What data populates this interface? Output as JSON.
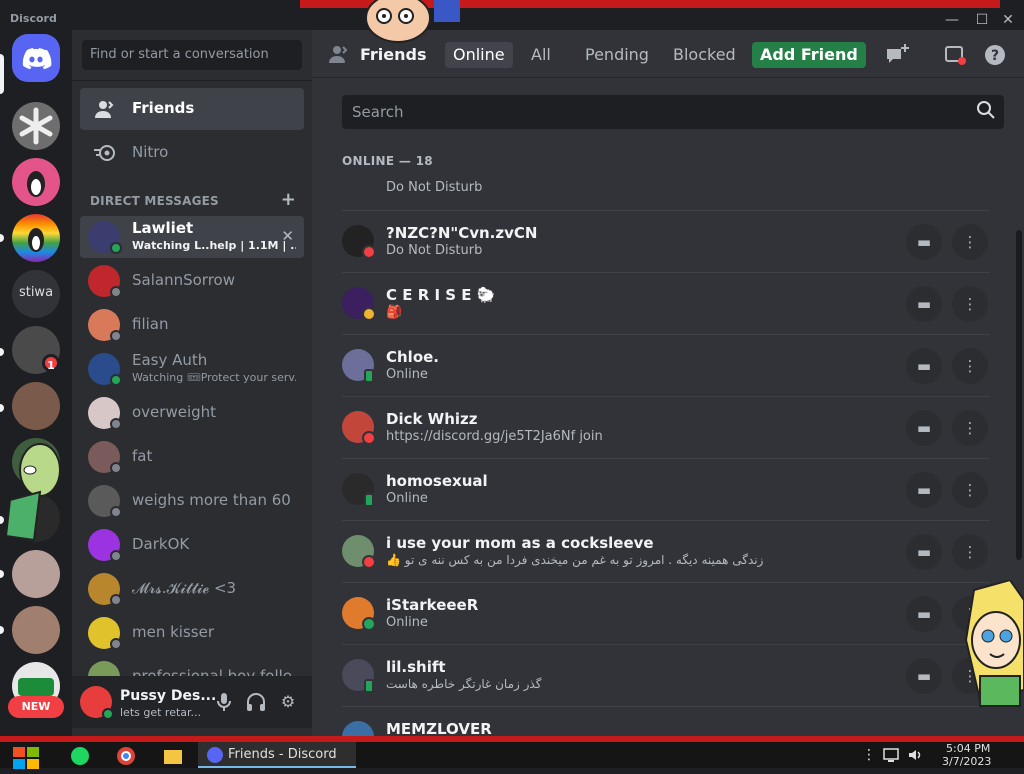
{
  "window": {
    "title": "Discord"
  },
  "rail": {
    "items": [
      {
        "name": "Direct Messages",
        "icon": "discord-logo-icon",
        "color": "#5865f2"
      },
      {
        "name": "Server 1",
        "color": "#6e6e6e"
      },
      {
        "name": "Server 2",
        "color": "#e2548a"
      },
      {
        "name": "Server 3",
        "color": "#d04a9b"
      },
      {
        "name": "stiwa",
        "label": "stiwa",
        "color": "#313338"
      },
      {
        "name": "Server 5",
        "color": "#4a4a4a",
        "badge": "1"
      },
      {
        "name": "Server 6",
        "color": "#7a5a4a"
      },
      {
        "name": "Server 7",
        "color": "#3e5e3e"
      },
      {
        "name": "Server 8",
        "color": "#2a2a2a"
      },
      {
        "name": "Server 9",
        "color": "#b7a09a"
      },
      {
        "name": "Server 10",
        "color": "#a07f6e"
      },
      {
        "name": "Server 11",
        "color": "#e7e7e7"
      }
    ],
    "new_badge": "NEW"
  },
  "dm_column": {
    "search_placeholder": "Find or start a conversation",
    "nav": [
      {
        "label": "Friends",
        "icon": "friends-icon"
      },
      {
        "label": "Nitro",
        "icon": "nitro-icon"
      }
    ],
    "section_header": "DIRECT MESSAGES",
    "add_dm": "+",
    "dms": [
      {
        "name": "Lawliet",
        "sub": "Watching L..help | 1.1M | ...",
        "status": "online",
        "color": "#3b3d6e",
        "active": true
      },
      {
        "name": "SalannSorrow",
        "sub": "",
        "status": "offline",
        "color": "#c0272d"
      },
      {
        "name": "filian",
        "sub": "",
        "status": "offline",
        "color": "#d87a5a"
      },
      {
        "name": "Easy Auth",
        "sub": "Watching 🎟Protect your serv...",
        "status": "online",
        "color": "#2b4c8c"
      },
      {
        "name": "overweight",
        "sub": "",
        "status": "offline",
        "color": "#d8c7c7"
      },
      {
        "name": "fat",
        "sub": "",
        "status": "offline",
        "color": "#7a5a5a"
      },
      {
        "name": "weighs more than 60",
        "sub": "",
        "status": "offline",
        "color": "#5a5a5a"
      },
      {
        "name": "DarkOK",
        "sub": "",
        "status": "offline",
        "color": "#9b33e0"
      },
      {
        "name": "𝓜𝓻𝓼.𝓚𝓲𝓽𝓽𝓲𝓮 <3",
        "sub": "",
        "status": "offline",
        "color": "#b8862d"
      },
      {
        "name": "men kisser",
        "sub": "",
        "status": "offline",
        "color": "#e0c22d"
      },
      {
        "name": "professional boy folle",
        "sub": "",
        "status": "offline",
        "color": "#7a9a5a"
      }
    ]
  },
  "user_panel": {
    "name": "Pussy Des...",
    "sub": "lets get retar...",
    "mic_icon": "microphone-icon",
    "headset_icon": "headphones-icon",
    "settings_icon": "gear-icon"
  },
  "main": {
    "header_label": "Friends",
    "tabs": [
      "Online",
      "All",
      "Pending",
      "Blocked"
    ],
    "add_friend": "Add Friend",
    "search_placeholder": "Search",
    "online_header": "ONLINE — 18",
    "partial_top_sub": "Do Not Disturb",
    "friends": [
      {
        "name": "?NZC?N\"Cvn.zvCN",
        "sub": "Do Not Disturb",
        "status": "dnd",
        "color": "#222"
      },
      {
        "name": "C E R I S E 🐑",
        "sub": "🎒",
        "status": "idle",
        "color": "#3b1f5e"
      },
      {
        "name": "Chloe.",
        "sub": "Online",
        "status": "mobile",
        "color": "#6b6f9a"
      },
      {
        "name": "Dick Whizz",
        "sub": "https://discord.gg/je5T2Ja6Nf join",
        "status": "dnd",
        "color": "#c2473a"
      },
      {
        "name": "homosexual",
        "sub": "Online",
        "status": "mobile",
        "color": "#2a2a2a"
      },
      {
        "name": "i use your mom as a cocksleeve",
        "sub": "👍 زندگی همینه دیگه . امروز تو به غم من میخندی فردا من به کس ننه ی تو",
        "status": "dnd",
        "color": "#6e8e6e"
      },
      {
        "name": "iStarkeeeR",
        "sub": "Online",
        "status": "online",
        "color": "#e07a2d"
      },
      {
        "name": "lil.shift",
        "sub": "گذر زمان غارتگر خاطره هاست",
        "status": "mobile",
        "color": "#4a4a5a"
      },
      {
        "name": "MEMZLOVER",
        "sub": "",
        "status": "online",
        "color": "#3a6ea5"
      }
    ]
  },
  "taskbar": {
    "active_app": "Friends - Discord",
    "time": "5:04 PM",
    "date": "3/7/2023"
  },
  "colors": {
    "online": "#23a55a",
    "idle": "#f0b232",
    "dnd": "#f23f43",
    "offline": "#80848e",
    "accent": "#5865f2"
  }
}
